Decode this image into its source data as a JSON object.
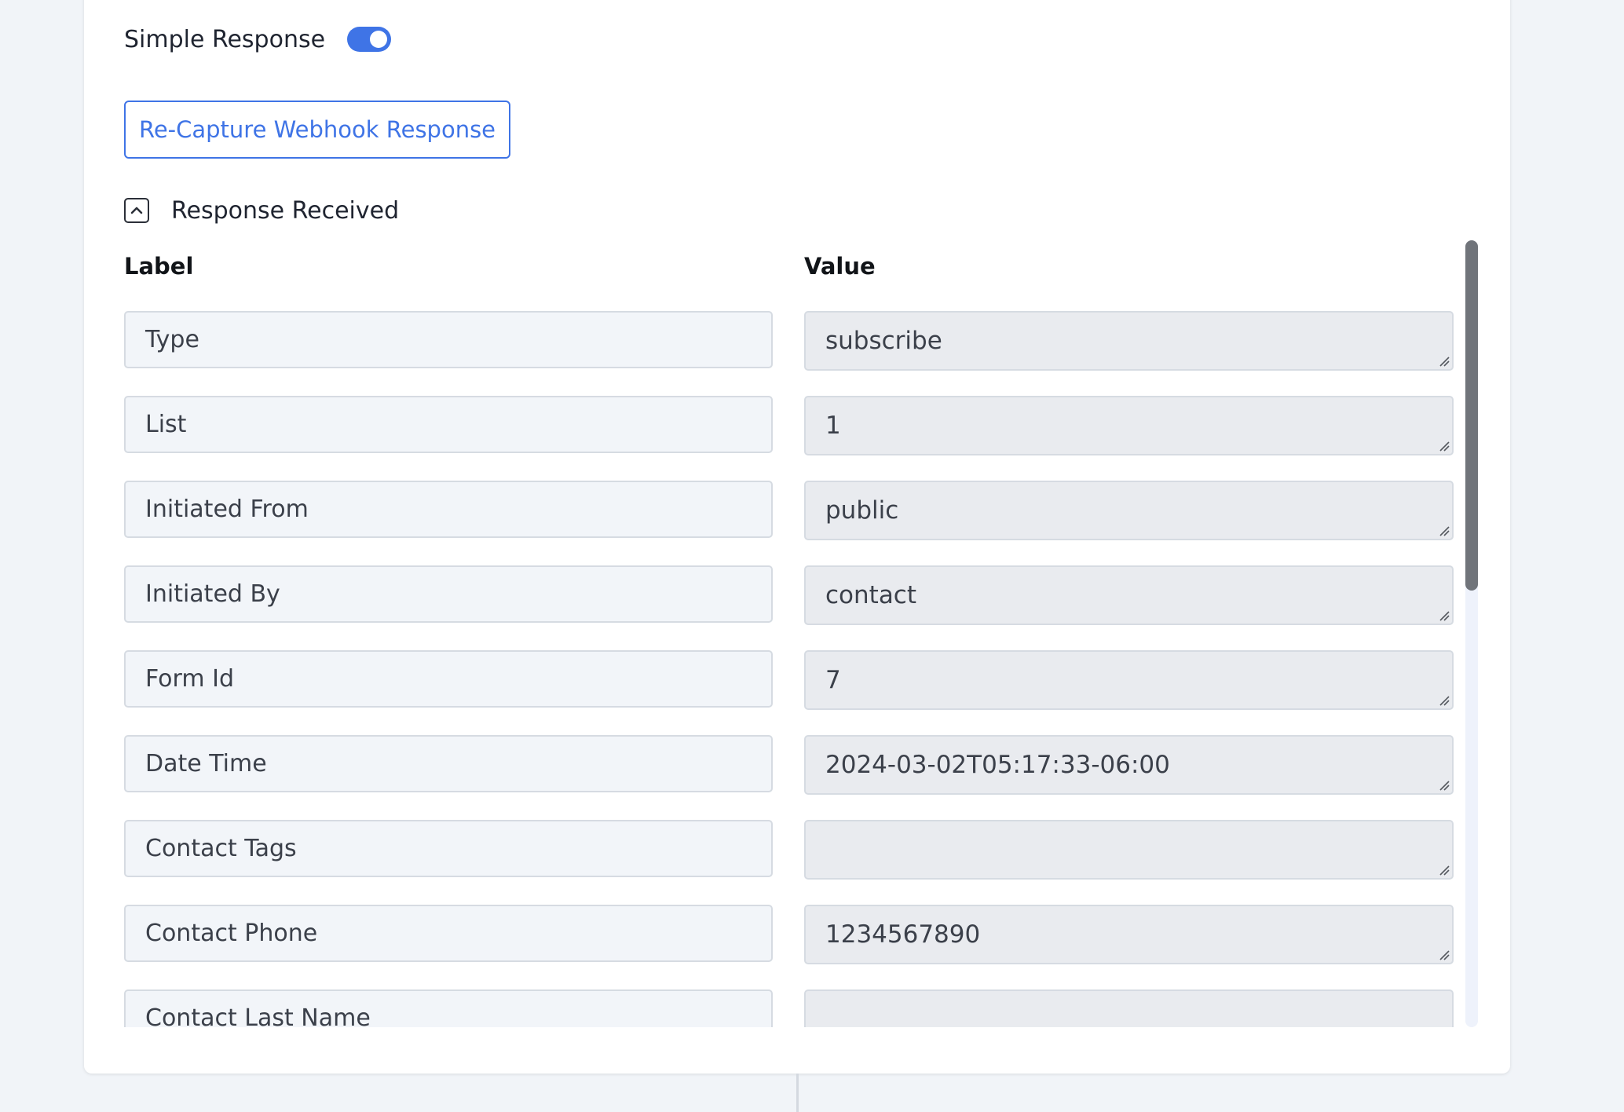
{
  "settings": {
    "simple_response_label": "Simple Response",
    "simple_response_on": true,
    "recapture_label": "Re-Capture Webhook Response"
  },
  "response": {
    "section_title": "Response Received",
    "label_header": "Label",
    "value_header": "Value",
    "rows": [
      {
        "label": "Type",
        "value": "subscribe"
      },
      {
        "label": "List",
        "value": "1"
      },
      {
        "label": "Initiated From",
        "value": "public"
      },
      {
        "label": "Initiated By",
        "value": "contact"
      },
      {
        "label": "Form Id",
        "value": "7"
      },
      {
        "label": "Date Time",
        "value": "2024-03-02T05:17:33-06:00"
      },
      {
        "label": "Contact Tags",
        "value": ""
      },
      {
        "label": "Contact Phone",
        "value": "1234567890"
      },
      {
        "label": "Contact Last Name",
        "value": ""
      }
    ]
  },
  "colors": {
    "accent": "#3f74e6",
    "label_field_bg": "#f2f5f9",
    "value_field_bg": "#e9ebef",
    "scrollbar_thumb": "#70747a"
  },
  "icons": {
    "collapse": "chevron-up-icon",
    "resize": "resize-grip-icon"
  }
}
